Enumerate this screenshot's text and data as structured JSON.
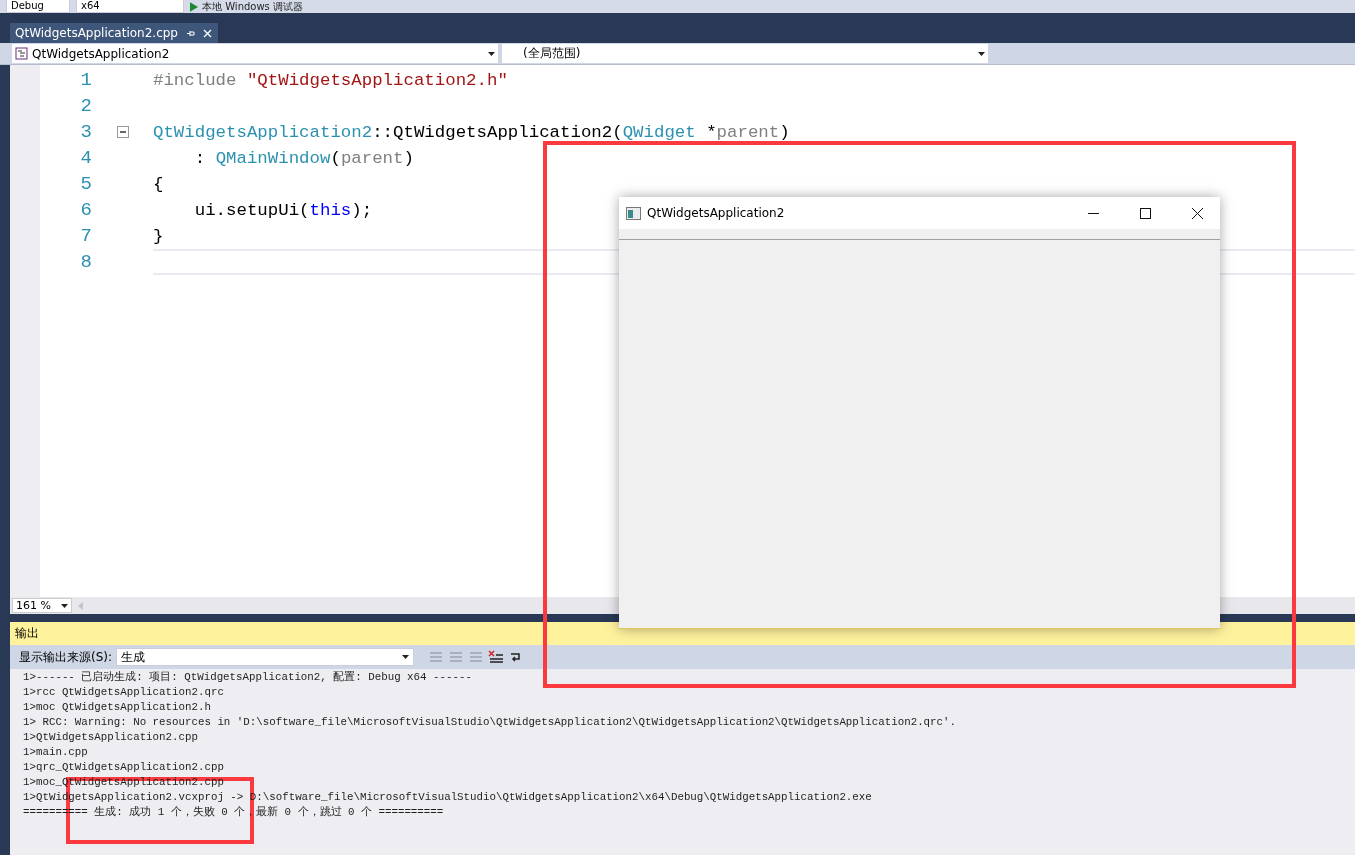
{
  "toolbar": {
    "configuration": "Debug",
    "platform": "x64",
    "debugger": "本地 Windows 调试器"
  },
  "document_tabs": [
    {
      "label": "QtWidgetsApplication2.cpp",
      "selected": true
    }
  ],
  "navigation": {
    "class_scope": "QtWidgetsApplication2",
    "member_scope": "(全局范围)"
  },
  "editor": {
    "lines": [
      {
        "number": "1",
        "fold_button": false,
        "current": false,
        "tokens": [
          {
            "text": "#include ",
            "kind": "directive"
          },
          {
            "text": "\"QtWidgetsApplication2.h\"",
            "kind": "string"
          }
        ]
      },
      {
        "number": "2",
        "fold_button": false,
        "current": false
      },
      {
        "number": "3",
        "fold_button": true,
        "current": false,
        "tokens": [
          {
            "text": "QtWidgetsApplication2",
            "kind": "type"
          },
          {
            "text": "::QtWidgetsApplication2(",
            "kind": "plain"
          },
          {
            "text": "QWidget",
            "kind": "type"
          },
          {
            "text": " *",
            "kind": "plain"
          },
          {
            "text": "parent",
            "kind": "param"
          },
          {
            "text": ")",
            "kind": "plain"
          }
        ]
      },
      {
        "number": "4",
        "fold_button": false,
        "current": false,
        "tokens": [
          {
            "text": "    : ",
            "kind": "plain"
          },
          {
            "text": "QMainWindow",
            "kind": "type"
          },
          {
            "text": "(",
            "kind": "plain"
          },
          {
            "text": "parent",
            "kind": "param"
          },
          {
            "text": ")",
            "kind": "plain"
          }
        ]
      },
      {
        "number": "5",
        "fold_button": false,
        "current": false,
        "tokens": [
          {
            "text": "{",
            "kind": "plain"
          }
        ]
      },
      {
        "number": "6",
        "fold_button": false,
        "current": false,
        "tokens": [
          {
            "text": "    ui.setupUi(",
            "kind": "plain"
          },
          {
            "text": "this",
            "kind": "keyword"
          },
          {
            "text": ");",
            "kind": "plain"
          }
        ]
      },
      {
        "number": "7",
        "fold_button": false,
        "current": false,
        "tokens": [
          {
            "text": "}",
            "kind": "plain"
          }
        ]
      },
      {
        "number": "8",
        "fold_button": false,
        "current": true
      }
    ],
    "zoom": "161 %"
  },
  "output": {
    "title": "输出",
    "source_label": "显示输出来源(S):",
    "source": "生成",
    "lines": [
      "1>------ 已启动生成: 项目: QtWidgetsApplication2, 配置: Debug x64 ------",
      "1>rcc QtWidgetsApplication2.qrc",
      "1>moc QtWidgetsApplication2.h",
      "1> RCC: Warning: No resources in 'D:\\software_file\\MicrosoftVisualStudio\\QtWidgetsApplication2\\QtWidgetsApplication2\\QtWidgetsApplication2.qrc'.",
      "1>QtWidgetsApplication2.cpp",
      "1>main.cpp",
      "1>qrc_QtWidgetsApplication2.cpp",
      "1>moc_QtWidgetsApplication2.cpp",
      "1>QtWidgetsApplication2.vcxproj -> D:\\software_file\\MicrosoftVisualStudio\\QtWidgetsApplication2\\x64\\Debug\\QtWidgetsApplication2.exe",
      "========== 生成: 成功 1 个，失败 0 个，最新 0 个，跳过 0 个 =========="
    ]
  },
  "app_window": {
    "title": "QtWidgetsApplication2"
  }
}
